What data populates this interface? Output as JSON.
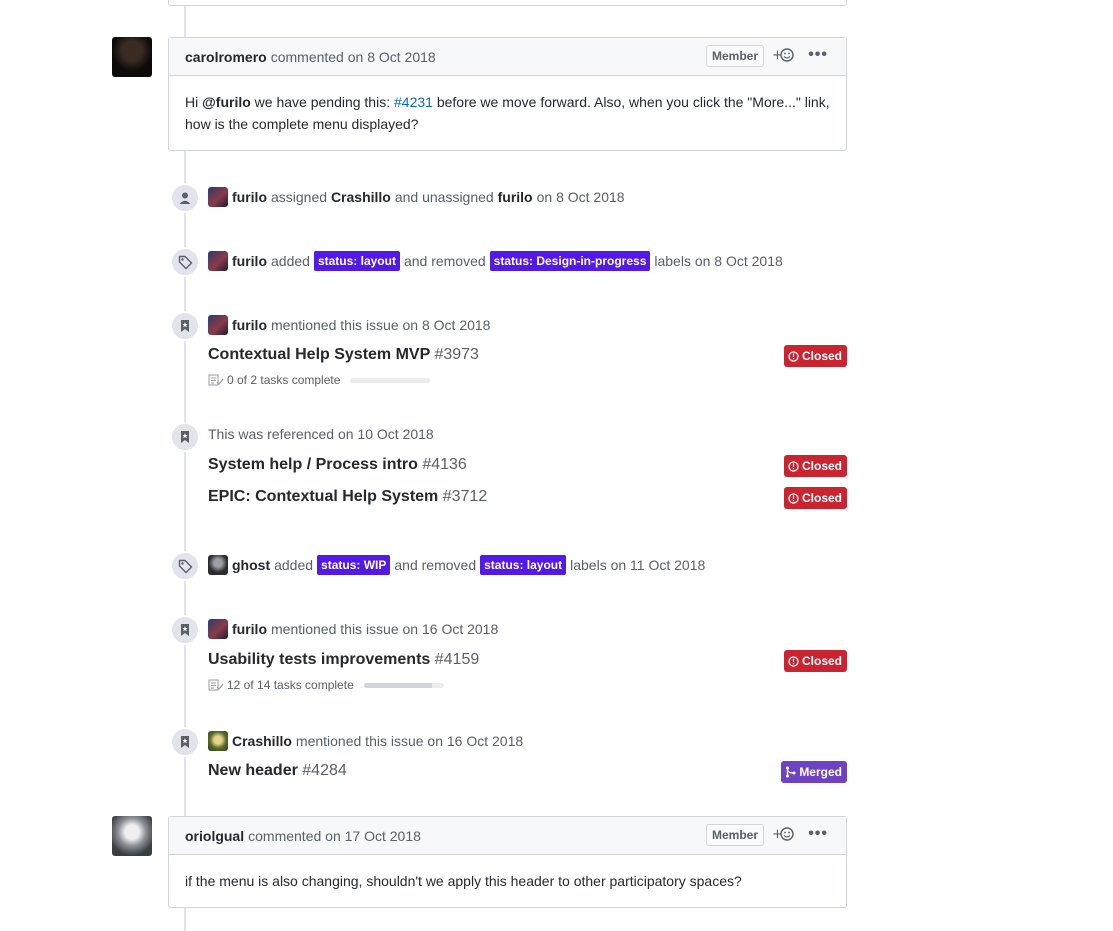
{
  "comment1": {
    "author": "carolromero",
    "meta": "commented on 8 Oct 2018",
    "badge": "Member",
    "body_pre": "Hi ",
    "mention": "@furilo",
    "body_mid": " we have pending this: ",
    "issue_link": "#4231",
    "body_post_line1": " before we move forward. Also, when you click the \"More...\" link,",
    "body_line2": "how is the complete menu displayed?"
  },
  "event_assign": {
    "actor": "furilo",
    "text1": "assigned",
    "target": "Crashillo",
    "text2": "and unassigned",
    "target2": "furilo",
    "date": "on 8 Oct 2018"
  },
  "event_labels1": {
    "actor": "furilo",
    "text1": "added",
    "label_added": "status: layout",
    "text2": "and removed",
    "label_removed": "status: Design-in-progress",
    "text3": "labels on 8 Oct 2018"
  },
  "event_mention1": {
    "actor": "furilo",
    "text": "mentioned this issue on 8 Oct 2018",
    "ref_title": "Contextual Help System MVP",
    "ref_num": "#3973",
    "state": "Closed",
    "tasks": "0 of 2 tasks complete",
    "progress": 0
  },
  "event_reference": {
    "text": "This was referenced on 10 Oct 2018",
    "refs": [
      {
        "title": "System help / Process intro",
        "num": "#4136",
        "state": "Closed"
      },
      {
        "title": "EPIC: Contextual Help System",
        "num": "#3712",
        "state": "Closed"
      }
    ]
  },
  "event_labels2": {
    "actor": "ghost",
    "text1": "added",
    "label_added": "status: WIP",
    "text2": "and removed",
    "label_removed": "status: layout",
    "text3": "labels on 11 Oct 2018"
  },
  "event_mention2": {
    "actor": "furilo",
    "text": "mentioned this issue on 16 Oct 2018",
    "ref_title": "Usability tests improvements",
    "ref_num": "#4159",
    "state": "Closed",
    "tasks": "12 of 14 tasks complete",
    "progress": 0.857
  },
  "event_mention3": {
    "actor": "Crashillo",
    "text": "mentioned this issue on 16 Oct 2018",
    "ref_title": "New header",
    "ref_num": "#4284",
    "state": "Merged"
  },
  "comment2": {
    "author": "oriolgual",
    "meta": "commented on 17 Oct 2018",
    "badge": "Member",
    "body": "if the menu is also changing, shouldn't we apply this header to other participatory spaces?"
  },
  "reaction_glyph": "+☺",
  "more_glyph": "•••",
  "colors": {
    "label_purple": "#5319e7",
    "closed_red": "#cb2431",
    "merged_purple": "#6f42c1",
    "link_blue": "#0366d6"
  }
}
